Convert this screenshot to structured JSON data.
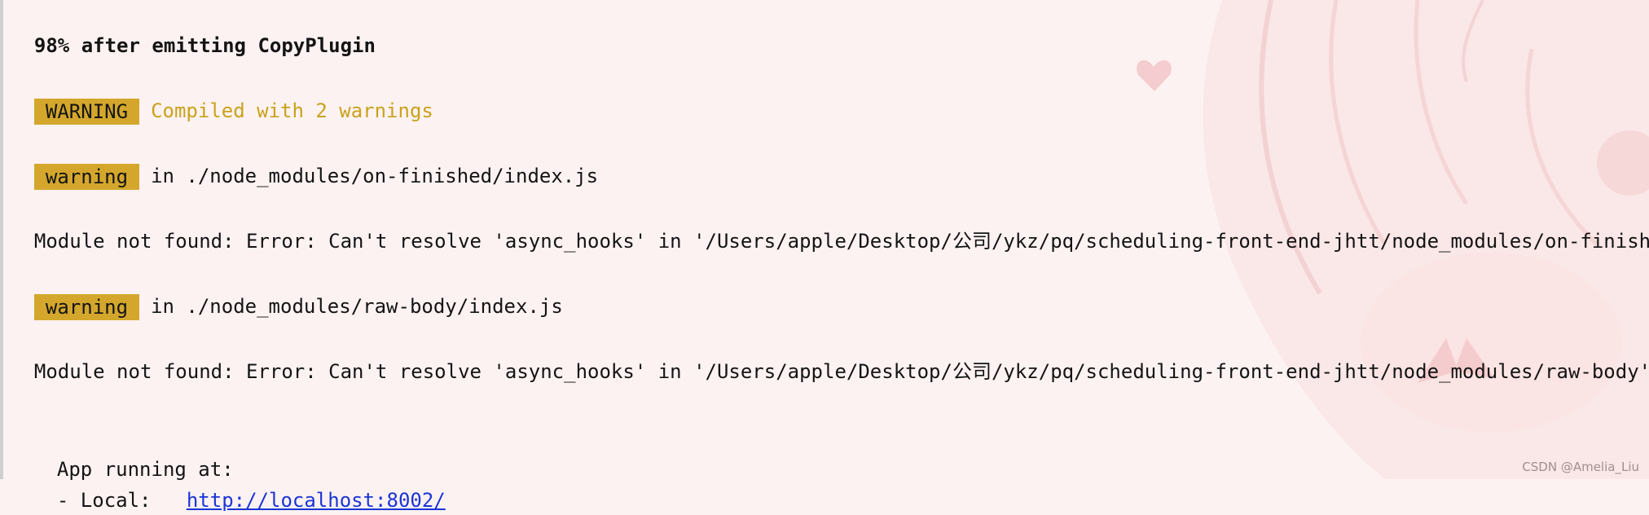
{
  "terminal": {
    "progress": "98% after emitting CopyPlugin",
    "summary_badge": "WARNING",
    "summary_text": "Compiled with 2 warnings",
    "warnings": [
      {
        "badge": "warning",
        "location": "in ./node_modules/on-finished/index.js",
        "message": "Module not found: Error: Can't resolve 'async_hooks' in '/Users/apple/Desktop/公司/ykz/pq/scheduling-front-end-jhtt/node_modules/on-finished'"
      },
      {
        "badge": "warning",
        "location": "in ./node_modules/raw-body/index.js",
        "message": "Module not found: Error: Can't resolve 'async_hooks' in '/Users/apple/Desktop/公司/ykz/pq/scheduling-front-end-jhtt/node_modules/raw-body'"
      }
    ],
    "app_running": "App running at:",
    "local_label": "- Local:",
    "local_url": "http://localhost:8002/"
  },
  "watermark": "CSDN @Amelia_Liu",
  "colors": {
    "background": "#fdf2f2",
    "badge": "#d4a72c",
    "warning_text": "#c9a21c",
    "link": "#1a35d6"
  }
}
